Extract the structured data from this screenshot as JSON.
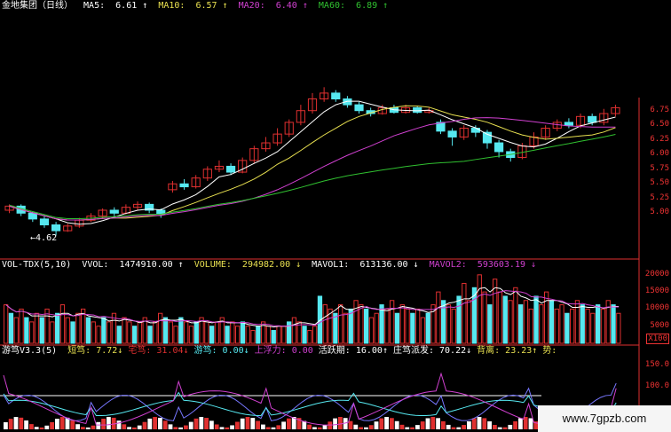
{
  "colors": {
    "up": "#e03030",
    "down": "#56e8f0",
    "ma5": "#ffffff",
    "ma10": "#e8e050",
    "ma20": "#d040d0",
    "ma60": "#30c030",
    "axis": "#e03030"
  },
  "price": {
    "title": "金地集团（日线）",
    "ma5": {
      "label": "MA5:",
      "value": "6.61"
    },
    "ma10": {
      "label": "MA10:",
      "value": "6.57"
    },
    "ma20": {
      "label": "MA20:",
      "value": "6.40"
    },
    "ma60": {
      "label": "MA60:",
      "value": "6.89"
    },
    "low_marker": "4.62",
    "ticks": [
      "6.75",
      "6.50",
      "6.25",
      "6.00",
      "5.75",
      "5.50",
      "5.25",
      "5.00"
    ],
    "candles": [
      [
        5.05,
        5.12,
        5.0,
        5.15
      ],
      [
        5.12,
        5.0,
        4.95,
        5.15
      ],
      [
        5.0,
        4.9,
        4.85,
        5.02
      ],
      [
        4.9,
        4.8,
        4.75,
        4.95
      ],
      [
        4.8,
        4.7,
        4.62,
        4.85
      ],
      [
        4.7,
        4.78,
        4.68,
        4.82
      ],
      [
        4.78,
        4.88,
        4.75,
        4.92
      ],
      [
        4.88,
        4.95,
        4.85,
        5.0
      ],
      [
        4.95,
        5.05,
        4.9,
        5.08
      ],
      [
        5.05,
        5.0,
        4.95,
        5.1
      ],
      [
        5.0,
        5.1,
        4.98,
        5.15
      ],
      [
        5.1,
        5.15,
        5.05,
        5.2
      ],
      [
        5.15,
        5.05,
        5.0,
        5.18
      ],
      [
        5.05,
        4.98,
        4.92,
        5.08
      ],
      [
        5.4,
        5.5,
        5.35,
        5.55
      ],
      [
        5.5,
        5.45,
        5.4,
        5.58
      ],
      [
        5.45,
        5.6,
        5.42,
        5.65
      ],
      [
        5.6,
        5.75,
        5.55,
        5.8
      ],
      [
        5.75,
        5.8,
        5.7,
        5.9
      ],
      [
        5.8,
        5.7,
        5.65,
        5.85
      ],
      [
        5.7,
        5.9,
        5.68,
        5.95
      ],
      [
        5.9,
        6.1,
        5.85,
        6.15
      ],
      [
        6.1,
        6.2,
        6.05,
        6.3
      ],
      [
        6.2,
        6.35,
        6.15,
        6.45
      ],
      [
        6.35,
        6.55,
        6.3,
        6.6
      ],
      [
        6.55,
        6.75,
        6.5,
        6.85
      ],
      [
        6.75,
        6.95,
        6.7,
        7.05
      ],
      [
        6.95,
        7.05,
        6.9,
        7.15
      ],
      [
        7.05,
        6.95,
        6.9,
        7.1
      ],
      [
        6.95,
        6.85,
        6.8,
        7.0
      ],
      [
        6.85,
        6.75,
        6.7,
        6.9
      ],
      [
        6.75,
        6.7,
        6.65,
        6.8
      ],
      [
        6.7,
        6.8,
        6.68,
        6.85
      ],
      [
        6.8,
        6.72,
        6.7,
        6.85
      ],
      [
        6.72,
        6.8,
        6.7,
        6.85
      ],
      [
        6.8,
        6.72,
        6.7,
        6.82
      ],
      [
        6.72,
        6.75,
        6.7,
        6.8
      ],
      [
        6.55,
        6.4,
        6.35,
        6.6
      ],
      [
        6.4,
        6.3,
        6.15,
        6.45
      ],
      [
        6.3,
        6.45,
        6.25,
        6.5
      ],
      [
        6.45,
        6.38,
        6.3,
        6.5
      ],
      [
        6.38,
        6.2,
        6.1,
        6.42
      ],
      [
        6.2,
        6.05,
        5.95,
        6.25
      ],
      [
        6.05,
        5.95,
        5.88,
        6.1
      ],
      [
        5.95,
        6.15,
        5.92,
        6.2
      ],
      [
        6.15,
        6.3,
        6.1,
        6.38
      ],
      [
        6.3,
        6.45,
        6.25,
        6.5
      ],
      [
        6.45,
        6.55,
        6.4,
        6.6
      ],
      [
        6.55,
        6.5,
        6.45,
        6.62
      ],
      [
        6.5,
        6.65,
        6.45,
        6.7
      ],
      [
        6.65,
        6.55,
        6.5,
        6.7
      ],
      [
        6.55,
        6.7,
        6.5,
        6.78
      ],
      [
        6.7,
        6.8,
        6.65,
        6.85
      ]
    ]
  },
  "volume": {
    "indicator": "VOL-TDX(5,10)",
    "vvol": {
      "label": "VVOL:",
      "value": "1474910.00"
    },
    "volume": {
      "label": "VOLUME:",
      "value": "294982.00"
    },
    "mavol1": {
      "label": "MAVOL1:",
      "value": "613136.00"
    },
    "mavol2": {
      "label": "MAVOL2:",
      "value": "593603.19"
    },
    "ticks": [
      "20000",
      "15000",
      "10000",
      "5000"
    ],
    "unit": "X100",
    "bars": [
      9,
      7,
      6,
      8,
      6,
      5,
      7,
      6,
      8,
      5,
      7,
      9,
      6,
      5,
      7,
      8,
      6,
      5,
      4,
      6,
      5,
      7,
      4,
      6,
      5,
      4,
      5,
      6,
      4,
      5,
      7,
      6,
      5,
      4,
      6,
      5,
      4,
      5,
      6,
      5,
      4,
      5,
      6,
      4,
      5,
      4,
      5,
      4,
      3,
      4,
      5,
      4,
      3,
      4,
      4,
      5,
      6,
      5,
      4,
      3,
      4,
      11,
      9,
      8,
      7,
      9,
      7,
      8,
      10,
      9,
      8,
      6,
      7,
      9,
      8,
      10,
      7,
      9,
      8,
      7,
      8,
      6,
      7,
      9,
      12,
      10,
      9,
      8,
      11,
      14,
      10,
      13,
      16,
      12,
      9,
      15,
      12,
      11,
      10,
      13,
      9,
      10,
      8,
      11,
      9,
      12,
      10,
      8,
      9,
      7,
      8,
      10,
      9,
      8,
      7,
      9,
      8,
      10,
      9,
      7
    ]
  },
  "tech": {
    "name": "游笃V3.3(5)",
    "fields": [
      {
        "label": "短笃:",
        "value": "7.72↓",
        "color": "#e8e050"
      },
      {
        "label": "宅笃:",
        "value": "31.04↓",
        "color": "#e03030"
      },
      {
        "label": "游笃:",
        "value": "0.00↓",
        "color": "#56e8f0"
      },
      {
        "label": "上浮力:",
        "value": "0.00",
        "color": "#d040d0"
      },
      {
        "label": "活跃期:",
        "value": "16.00↑",
        "color": "#ffffff"
      },
      {
        "label": "庄笃派发:",
        "value": "70.22↓",
        "color": "#ffffff"
      },
      {
        "label": "背离:",
        "value": "23.23↑",
        "color": "#e8e050"
      },
      {
        "label": "势:",
        "value": "",
        "color": "#e8e050"
      }
    ],
    "ticks": [
      "150.0",
      "100.0"
    ],
    "watermark": "www.7gpzb.com"
  }
}
